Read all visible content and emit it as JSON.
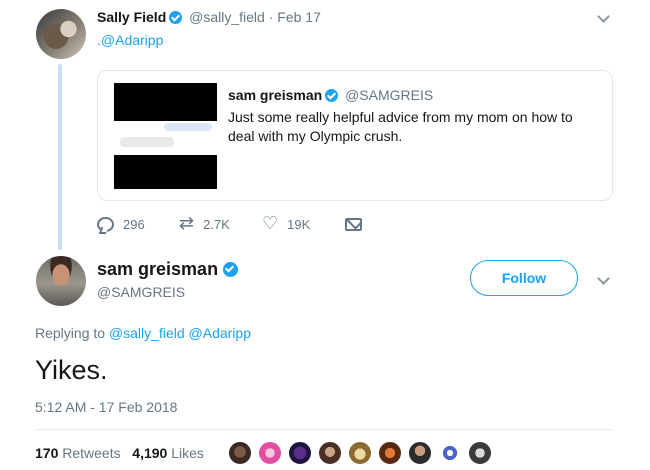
{
  "original_tweet": {
    "author_name": "Sally Field",
    "handle": "@sally_field",
    "date": "· Feb 17",
    "text": ".@Adaripp",
    "quoted": {
      "author_name": "sam greisman",
      "handle": "@SAMGREIS",
      "text": "Just some really helpful advice from my mom on how to deal with my Olympic crush."
    },
    "actions": {
      "replies": "296",
      "retweets": "2.7K",
      "likes": "19K"
    }
  },
  "reply_tweet": {
    "author_name": "sam greisman",
    "handle": "@SAMGREIS",
    "follow_label": "Follow",
    "replying_prefix": "Replying to",
    "replying_users": [
      "@sally_field",
      "@Adaripp"
    ],
    "text": "Yikes.",
    "timestamp": "5:12 AM - 17 Feb 2018",
    "stats": {
      "retweets_count": "170",
      "retweets_label": "Retweets",
      "likes_count": "4,190",
      "likes_label": "Likes"
    }
  },
  "colors": {
    "accent": "#1da1f2",
    "muted": "#657786",
    "thread_line": "#c4e0f5"
  },
  "icons": [
    "verified-icon",
    "chevron-down-icon",
    "reply-icon",
    "retweet-icon",
    "heart-icon",
    "mail-icon"
  ]
}
